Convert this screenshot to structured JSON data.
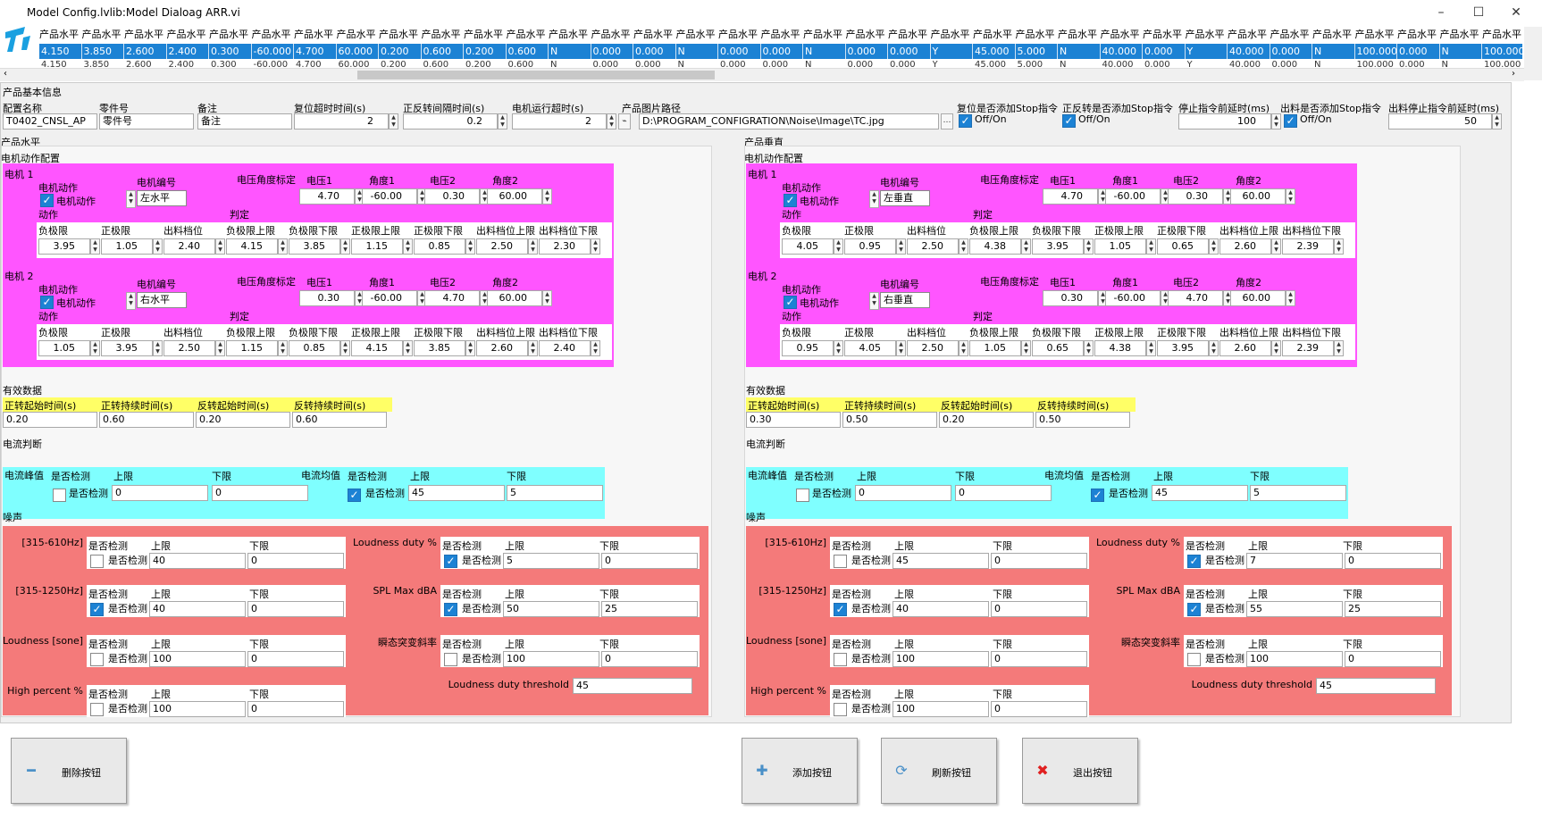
{
  "window": {
    "title": "Model Config.lvlib:Model Dialoag ARR.vi",
    "minimize": "–",
    "maximize": "☐",
    "close": "✕"
  },
  "grid": {
    "header_label": "产品水平",
    "row1": [
      "4.150",
      "3.850",
      "2.600",
      "2.400",
      "0.300",
      "-60.000",
      "4.700",
      "60.000",
      "0.200",
      "0.600",
      "0.200",
      "0.600",
      "N",
      "0.000",
      "0.000",
      "N",
      "0.000",
      "0.000",
      "N",
      "0.000",
      "0.000",
      "Y",
      "45.000",
      "5.000",
      "N",
      "40.000",
      "0.000",
      "Y",
      "40.000",
      "0.000",
      "N",
      "100.000",
      "0.000",
      "N",
      "100.000"
    ],
    "row2": [
      "4.150",
      "3.850",
      "2.600",
      "2.400",
      "0.300",
      "-60.000",
      "4.700",
      "60.000",
      "0.200",
      "0.600",
      "0.200",
      "0.600",
      "N",
      "0.000",
      "0.000",
      "N",
      "0.000",
      "0.000",
      "N",
      "0.000",
      "0.000",
      "Y",
      "45.000",
      "5.000",
      "N",
      "40.000",
      "0.000",
      "Y",
      "40.000",
      "0.000",
      "N",
      "100.000",
      "0.000",
      "N",
      "100.000"
    ]
  },
  "basic": {
    "section": "产品基本信息",
    "config_name_label": "配置名称",
    "config_name": "T0402_CNSL_AP",
    "part_label": "零件号",
    "part": "零件号",
    "note_label": "备注",
    "note": "备注",
    "reset_timeout_label": "复位超时时间(s)",
    "reset_timeout": "2",
    "rev_interval_label": "正反转间隔时间(s)",
    "rev_interval": "0.2",
    "motor_timeout_label": "电机运行超时(s)",
    "motor_timeout": "2",
    "image_path_label": "产品图片路径",
    "image_path": "D:\\PROGRAM_CONFIGRATION\\Noise\\Image\\TC.jpg",
    "reset_stop_label": "复位是否添加Stop指令",
    "offon": "Off/On",
    "rev_stop_label": "正反转是否添加Stop指令",
    "stop_delay_label": "停止指令前延时(ms)",
    "stop_delay": "100",
    "out_stop_label": "出料是否添加Stop指令",
    "out_stop_delay_label": "出料停止指令前延时(ms)",
    "out_stop_delay": "50"
  },
  "labels": {
    "motor_action_config": "电机动作配置",
    "motor1": "电机 1",
    "motor2": "电机 2",
    "motor_action": "电机动作",
    "motor_number": "电机编号",
    "voltage_angle_cal": "电压角度标定",
    "v1": "电压1",
    "a1": "角度1",
    "v2": "电压2",
    "a2": "角度2",
    "action": "动作",
    "judge": "判定",
    "neg_limit": "负极限",
    "pos_limit": "正极限",
    "out_pos": "出料档位",
    "neg_upper": "负极限上限",
    "neg_lower": "负极限下限",
    "pos_upper": "正极限上限",
    "pos_lower": "正极限下限",
    "out_upper": "出料档位上限",
    "out_lower": "出料档位下限",
    "valid_data": "有效数据",
    "fwd_start": "正转起始时间(s)",
    "fwd_dur": "正转持续时间(s)",
    "rev_start": "反转起始时间(s)",
    "rev_dur": "反转持续时间(s)",
    "current_judge": "电流判断",
    "current_peak": "电流峰值",
    "current_avg": "电流均值",
    "is_detect": "是否检测",
    "upper": "上限",
    "lower": "下限",
    "noise": "噪声",
    "band1": "[315-610Hz]",
    "band2": "[315-1250Hz]",
    "loudness": "Loudness [sone]",
    "high_percent": "High percent %",
    "duty": "Loudness duty %",
    "spl": "SPL Max dBA",
    "transient": "瞬态突变斜率",
    "duty_threshold": "Loudness duty threshold"
  },
  "horizontal": {
    "section": "产品水平",
    "m1": {
      "action_checked": true,
      "number": "左水平",
      "v1": "4.70",
      "a1": "-60.00",
      "v2": "0.30",
      "a2": "60.00",
      "neg": "3.95",
      "pos": "1.05",
      "out": "2.40",
      "neg_up": "4.15",
      "neg_lo": "3.85",
      "pos_up": "1.15",
      "pos_lo": "0.85",
      "out_up": "2.50",
      "out_lo": "2.30"
    },
    "m2": {
      "action_checked": true,
      "number": "右水平",
      "v1": "0.30",
      "a1": "-60.00",
      "v2": "4.70",
      "a2": "60.00",
      "neg": "1.05",
      "pos": "3.95",
      "out": "2.50",
      "neg_up": "1.15",
      "neg_lo": "0.85",
      "pos_up": "4.15",
      "pos_lo": "3.85",
      "out_up": "2.60",
      "out_lo": "2.40"
    },
    "valid": {
      "fwd_start": "0.20",
      "fwd_dur": "0.60",
      "rev_start": "0.20",
      "rev_dur": "0.60"
    },
    "current": {
      "peak_detect": false,
      "peak_up": "0",
      "peak_lo": "0",
      "avg_detect": true,
      "avg_up": "45",
      "avg_lo": "5"
    },
    "noise": {
      "band1": {
        "detect": false,
        "up": "40",
        "lo": "0"
      },
      "band2": {
        "detect": true,
        "up": "40",
        "lo": "0"
      },
      "loud": {
        "detect": false,
        "up": "100",
        "lo": "0"
      },
      "high": {
        "detect": false,
        "up": "100",
        "lo": "0"
      },
      "duty": {
        "detect": true,
        "up": "5",
        "lo": "0"
      },
      "spl": {
        "detect": true,
        "up": "50",
        "lo": "25"
      },
      "trans": {
        "detect": false,
        "up": "100",
        "lo": "0"
      },
      "threshold": "45"
    }
  },
  "vertical": {
    "section": "产品垂直",
    "m1": {
      "action_checked": true,
      "number": "左垂直",
      "v1": "4.70",
      "a1": "-60.00",
      "v2": "0.30",
      "a2": "60.00",
      "neg": "4.05",
      "pos": "0.95",
      "out": "2.50",
      "neg_up": "4.38",
      "neg_lo": "3.95",
      "pos_up": "1.05",
      "pos_lo": "0.65",
      "out_up": "2.60",
      "out_lo": "2.39"
    },
    "m2": {
      "action_checked": true,
      "number": "右垂直",
      "v1": "0.30",
      "a1": "-60.00",
      "v2": "4.70",
      "a2": "60.00",
      "neg": "0.95",
      "pos": "4.05",
      "out": "2.50",
      "neg_up": "1.05",
      "neg_lo": "0.65",
      "pos_up": "4.38",
      "pos_lo": "3.95",
      "out_up": "2.60",
      "out_lo": "2.39"
    },
    "valid": {
      "fwd_start": "0.30",
      "fwd_dur": "0.50",
      "rev_start": "0.20",
      "rev_dur": "0.50"
    },
    "current": {
      "peak_detect": false,
      "peak_up": "0",
      "peak_lo": "0",
      "avg_detect": true,
      "avg_up": "45",
      "avg_lo": "5"
    },
    "noise": {
      "band1": {
        "detect": false,
        "up": "45",
        "lo": "0"
      },
      "band2": {
        "detect": true,
        "up": "40",
        "lo": "0"
      },
      "loud": {
        "detect": false,
        "up": "100",
        "lo": "0"
      },
      "high": {
        "detect": false,
        "up": "100",
        "lo": "0"
      },
      "duty": {
        "detect": true,
        "up": "7",
        "lo": "0"
      },
      "spl": {
        "detect": true,
        "up": "55",
        "lo": "25"
      },
      "trans": {
        "detect": false,
        "up": "100",
        "lo": "0"
      },
      "threshold": "45"
    }
  },
  "buttons": {
    "delete": "删除按钮",
    "add": "添加按钮",
    "refresh": "刷新按钮",
    "exit": "退出按钮"
  },
  "colors": {
    "motor_panel": "#ff55ff",
    "noise_panel": "#f47a7a",
    "valid_panel": "#ffff66",
    "current_panel": "#7fffff",
    "selection": "#1c82d4"
  }
}
